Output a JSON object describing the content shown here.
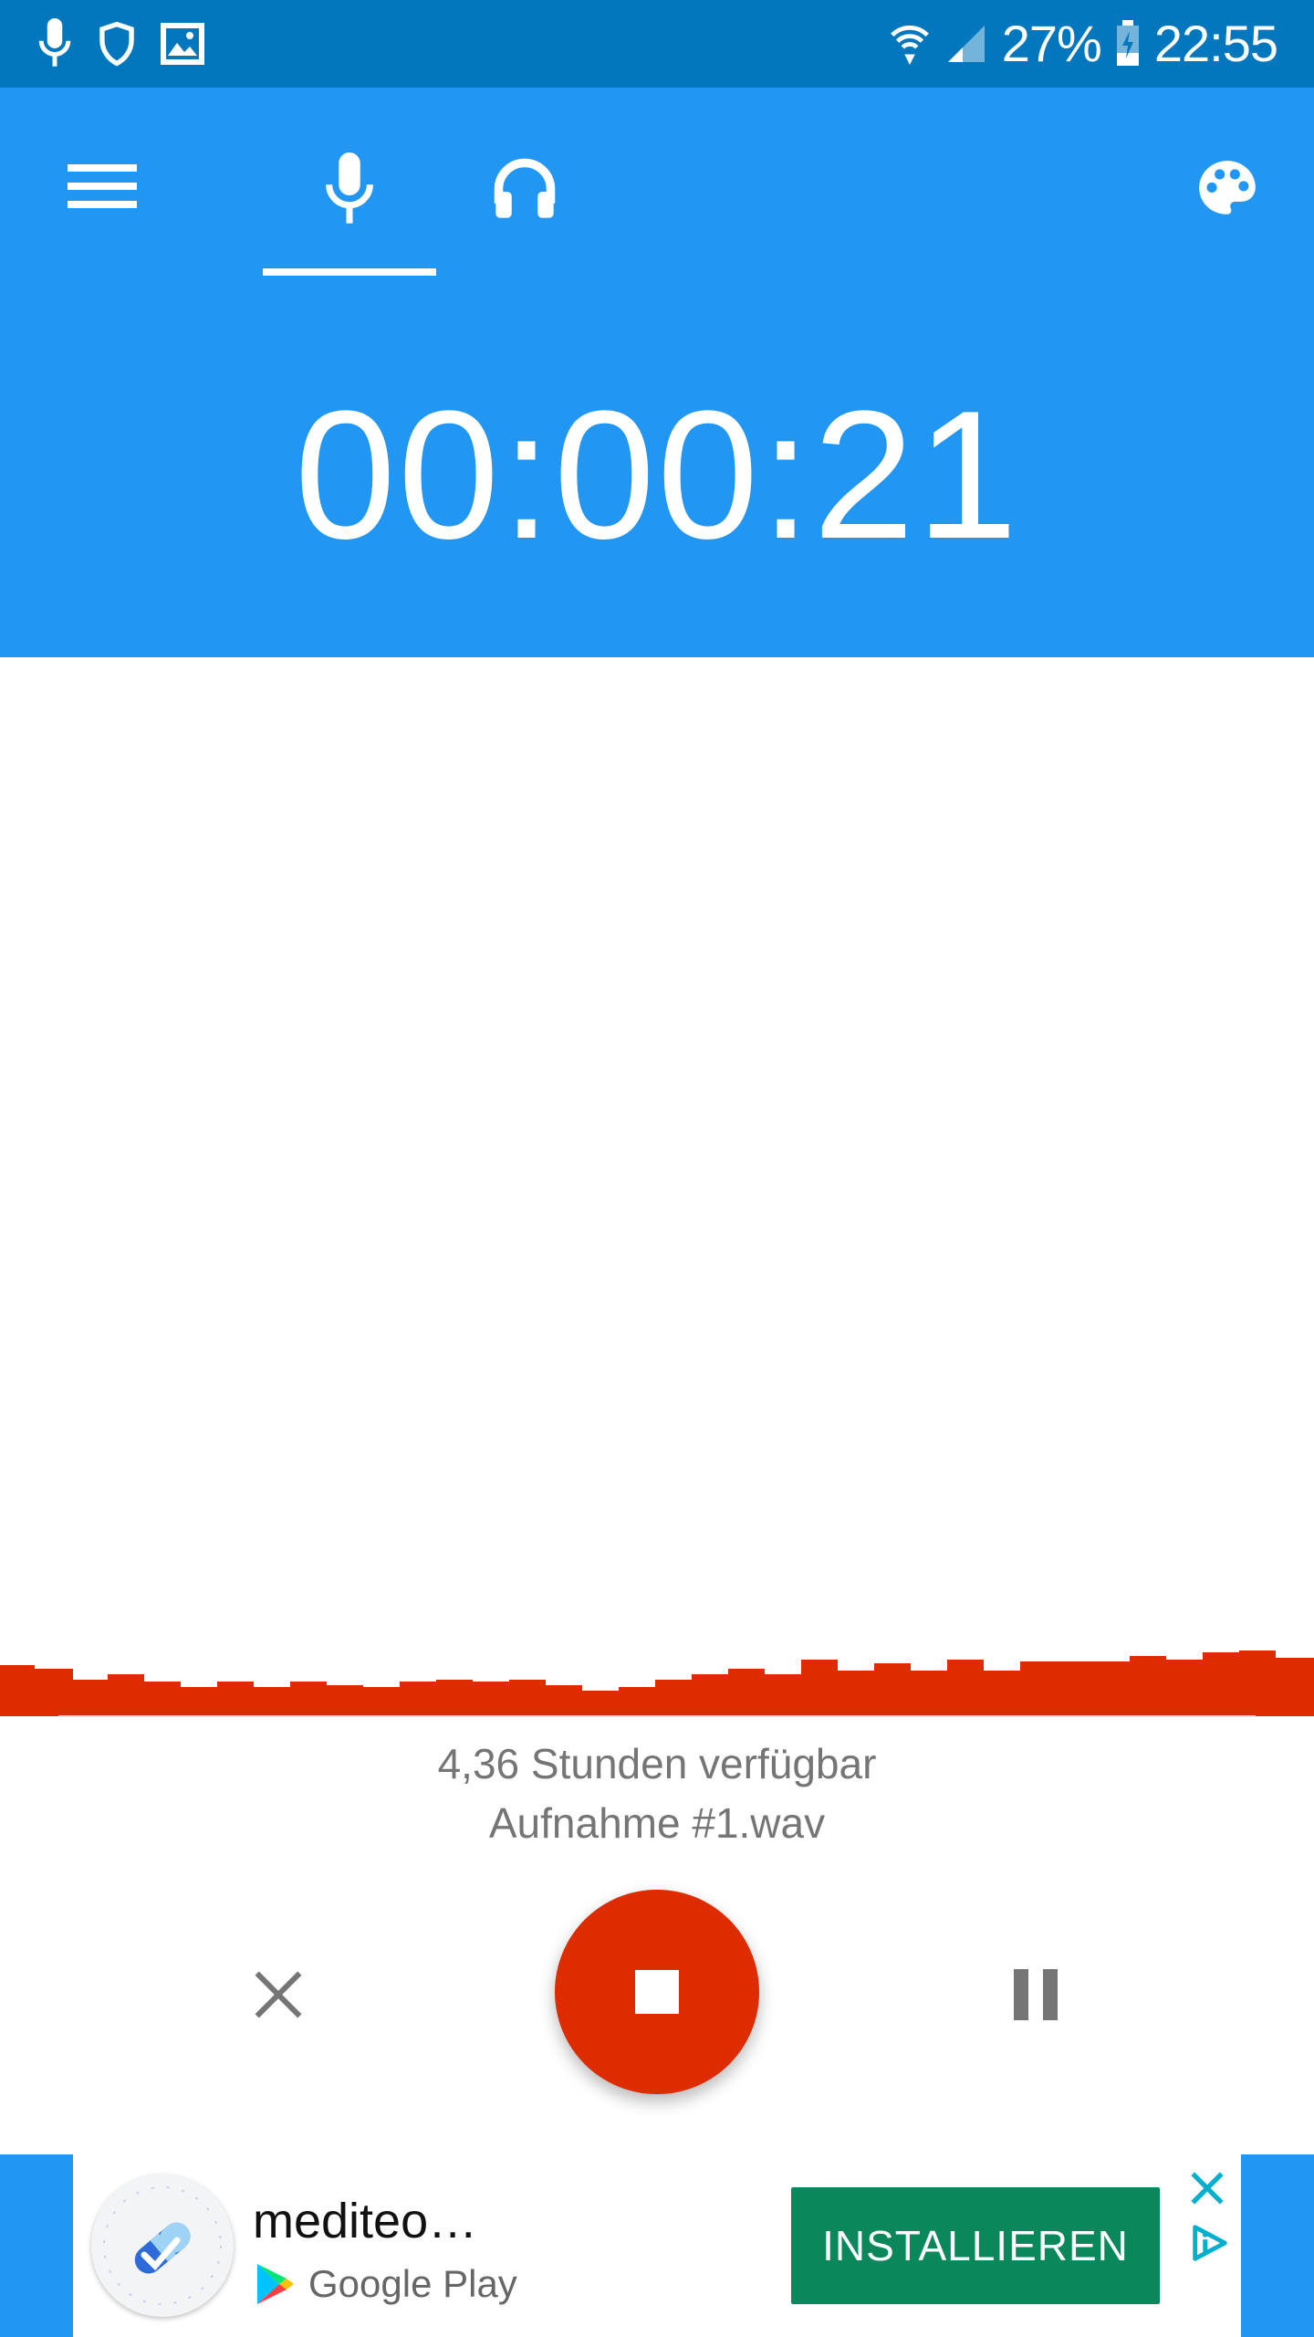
{
  "status_bar": {
    "battery": "27%",
    "time": "22:55"
  },
  "app_bar": {
    "tabs": [
      {
        "icon": "microphone-icon",
        "selected": true
      },
      {
        "icon": "headphones-icon",
        "selected": false
      }
    ],
    "timer": "00:00:21"
  },
  "info": {
    "available": "4,36 Stunden verfügbar",
    "filename": "Aufnahme #1.wav"
  },
  "controls": {
    "cancel_icon": "close-icon",
    "stop_icon": "stop-icon",
    "pause_icon": "pause-icon"
  },
  "ad": {
    "title": "mediteo…",
    "store": "Google Play",
    "install_label": "INSTALLIEREN"
  },
  "colors": {
    "status_bar": "#0277BD",
    "app_bar": "#2196F3",
    "record": "#DD2C00",
    "install": "#0A875B"
  }
}
